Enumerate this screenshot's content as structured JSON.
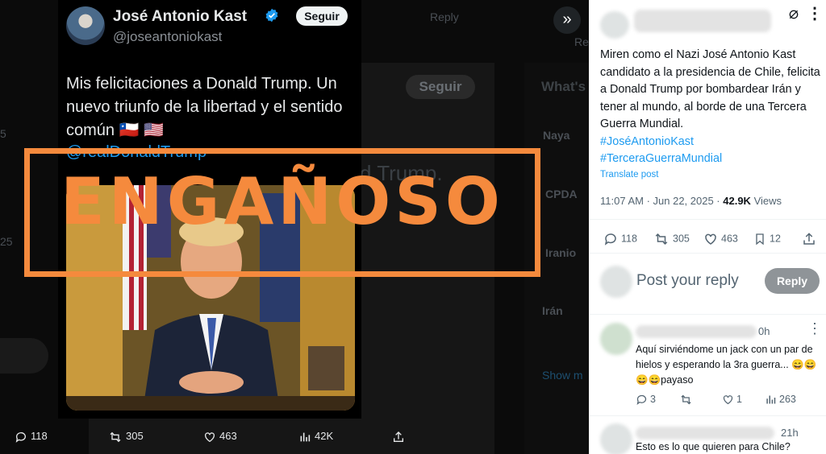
{
  "main_tweet": {
    "name": "José Antonio Kast",
    "handle": "@joseantoniokast",
    "follow_label": "Seguir",
    "text": "Mis felicitaciones a Donald Trump. Un nuevo triunfo de la libertad y el sentido común 🇨🇱 🇺🇸",
    "mention": "@realDonaldTrump",
    "stats": {
      "replies": "118",
      "reposts": "305",
      "likes": "463",
      "views": "42K"
    }
  },
  "background": {
    "reply_label": "Reply",
    "whats_label": "What's",
    "seguir_label": "Seguir",
    "trump_fragment": "d Trump.",
    "trend_names": [
      "Naya",
      "CPDA",
      "Iranio",
      "Irán"
    ],
    "show_more": "Show m",
    "re_label": "Re",
    "side_numbers": [
      "5",
      "25"
    ]
  },
  "stamp_text": "ENGAÑOSO",
  "reply_post": {
    "text": "Miren como el Nazi José Antonio Kast candidato a la presidencia de Chile, felicita a Donald Trump por bombardear Irán y tener al mundo, al borde de una Tercera Guerra Mundial.",
    "hashtags": [
      "#JoséAntonioKast",
      "#TerceraGuerraMundial"
    ],
    "translate": "Translate post",
    "time": "11:07 AM · Jun 22, 2025 · ",
    "views_count": "42.9K",
    "views_label": " Views",
    "stats": {
      "replies": "118",
      "reposts": "305",
      "likes": "463",
      "bookmarks": "12"
    },
    "reply_placeholder": "Post your reply",
    "reply_button": "Reply"
  },
  "comments": [
    {
      "time": "0h",
      "text": "Aquí sirviéndome un jack con un par de hielos y esperando la 3ra guerra... 😄😄😄😄payaso",
      "replies": "3",
      "likes": "1",
      "views": "263"
    },
    {
      "time": "21h",
      "text": "Esto es lo que  quieren  para Chile?"
    }
  ],
  "colors": {
    "stamp": "#f58a3d",
    "link": "#1d9bf0",
    "dark_bg": "#000000"
  }
}
